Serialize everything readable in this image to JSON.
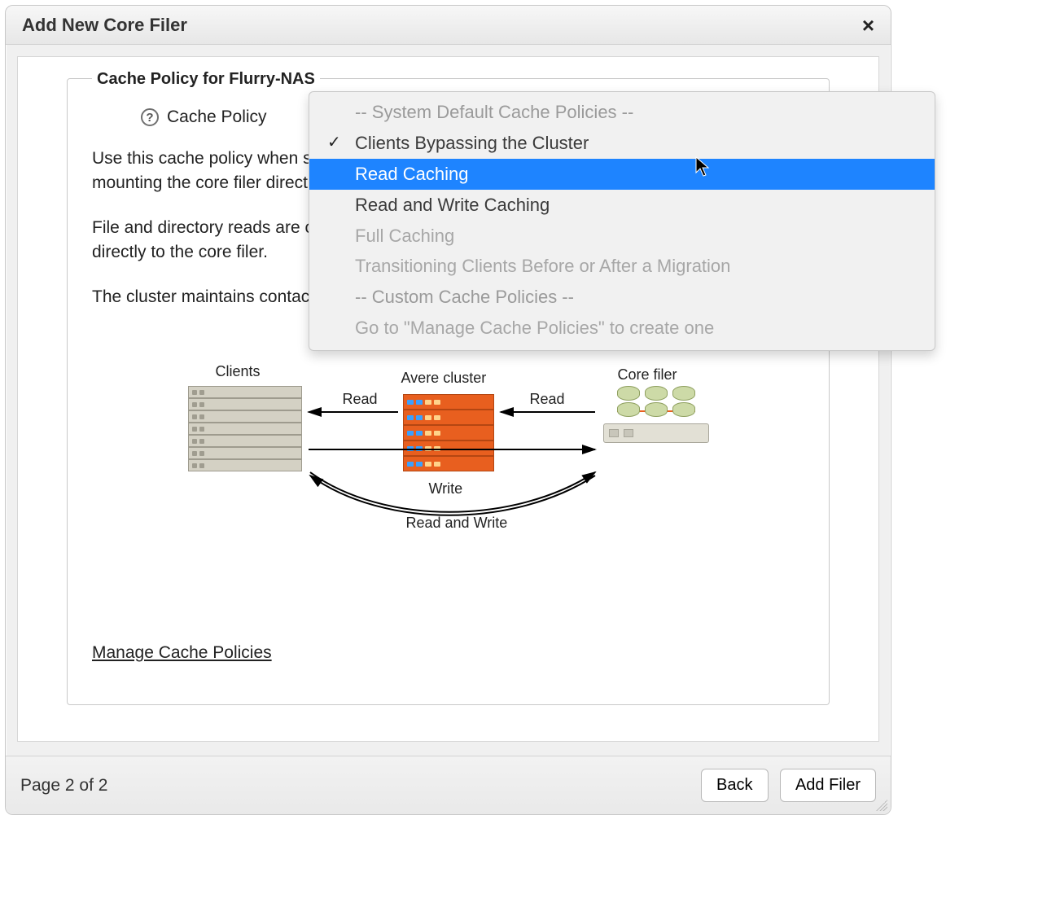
{
  "dialog": {
    "title": "Add New Core Filer",
    "close_label": "×"
  },
  "section": {
    "legend": "Cache Policy for Flurry-NAS",
    "cache_policy_label": "Cache Policy",
    "help_glyph": "?"
  },
  "descriptions": {
    "p1": "Use this cache policy when some clients are mounting the Avere cluster and others are mounting the core filer directly.",
    "p2": "File and directory reads are cached; clients see the benefits of Edge caching. Writes pass directly to the core filer.",
    "p3": "The cluster maintains contact with the core filer to maintain file system consistency."
  },
  "diagram": {
    "clients_label": "Clients",
    "cluster_label": "Avere cluster",
    "corefiler_label": "Core filer",
    "read_label_left": "Read",
    "read_label_right": "Read",
    "write_label": "Write",
    "rw_label": "Read and Write"
  },
  "manage_link": "Manage Cache Policies",
  "footer": {
    "page_indicator": "Page 2 of 2",
    "back_label": "Back",
    "add_label": "Add Filer"
  },
  "dropdown": {
    "group_system": "-- System Default Cache Policies --",
    "opt_bypass": "Clients Bypassing the Cluster",
    "opt_read": "Read Caching",
    "opt_rw": "Read and Write Caching",
    "opt_full": "Full Caching",
    "opt_trans": "Transitioning Clients Before or After a Migration",
    "group_custom": "-- Custom Cache Policies --",
    "opt_goto": "Go to \"Manage Cache Policies\" to create one"
  }
}
